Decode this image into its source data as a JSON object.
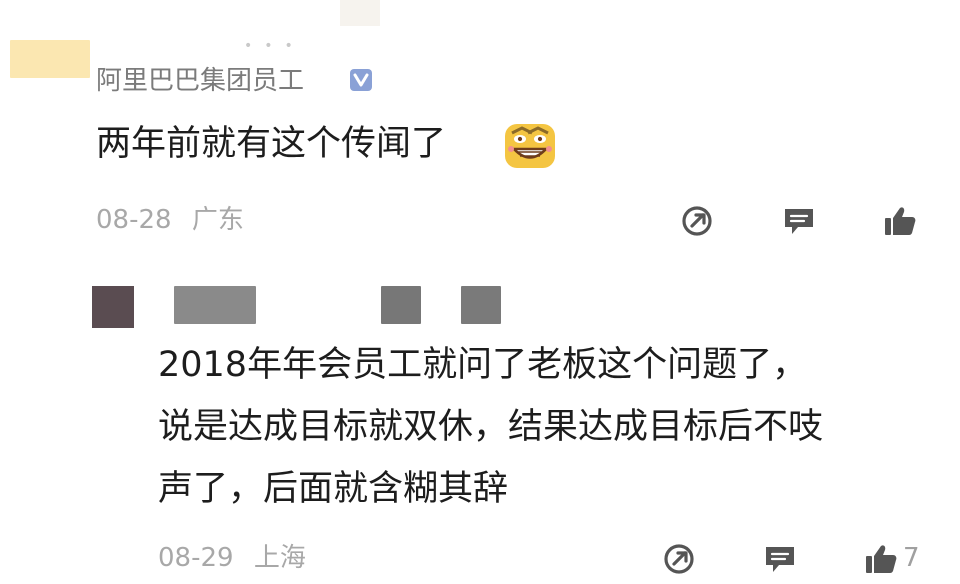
{
  "comment_1": {
    "author_name": "阿里巴巴集团员工",
    "verified_badge_icon": "verified-v-icon",
    "text": "两年前就有这个传闻了",
    "emoji_icon": "grinning-emoji-icon",
    "date": "08-28",
    "location": "广东",
    "actions": [
      "share-icon",
      "reply-icon",
      "like-icon"
    ]
  },
  "comment_2": {
    "text": "2018年年会员工就问了老板这个问题了，\n说是达成目标就双休，结果达成目标后不吱\n声了，后面就含糊其辞",
    "date": "08-29",
    "location": "上海",
    "actions": [
      "share-icon",
      "reply-icon",
      "like-icon"
    ],
    "like_count": "7"
  },
  "colors": {
    "text_primary": "#1d1d1d",
    "text_secondary": "#7b7b7b",
    "meta": "#a8a8a8",
    "icon": "#555555",
    "verified_badge": "#8aa1d6",
    "emoji": "#f4c542"
  }
}
